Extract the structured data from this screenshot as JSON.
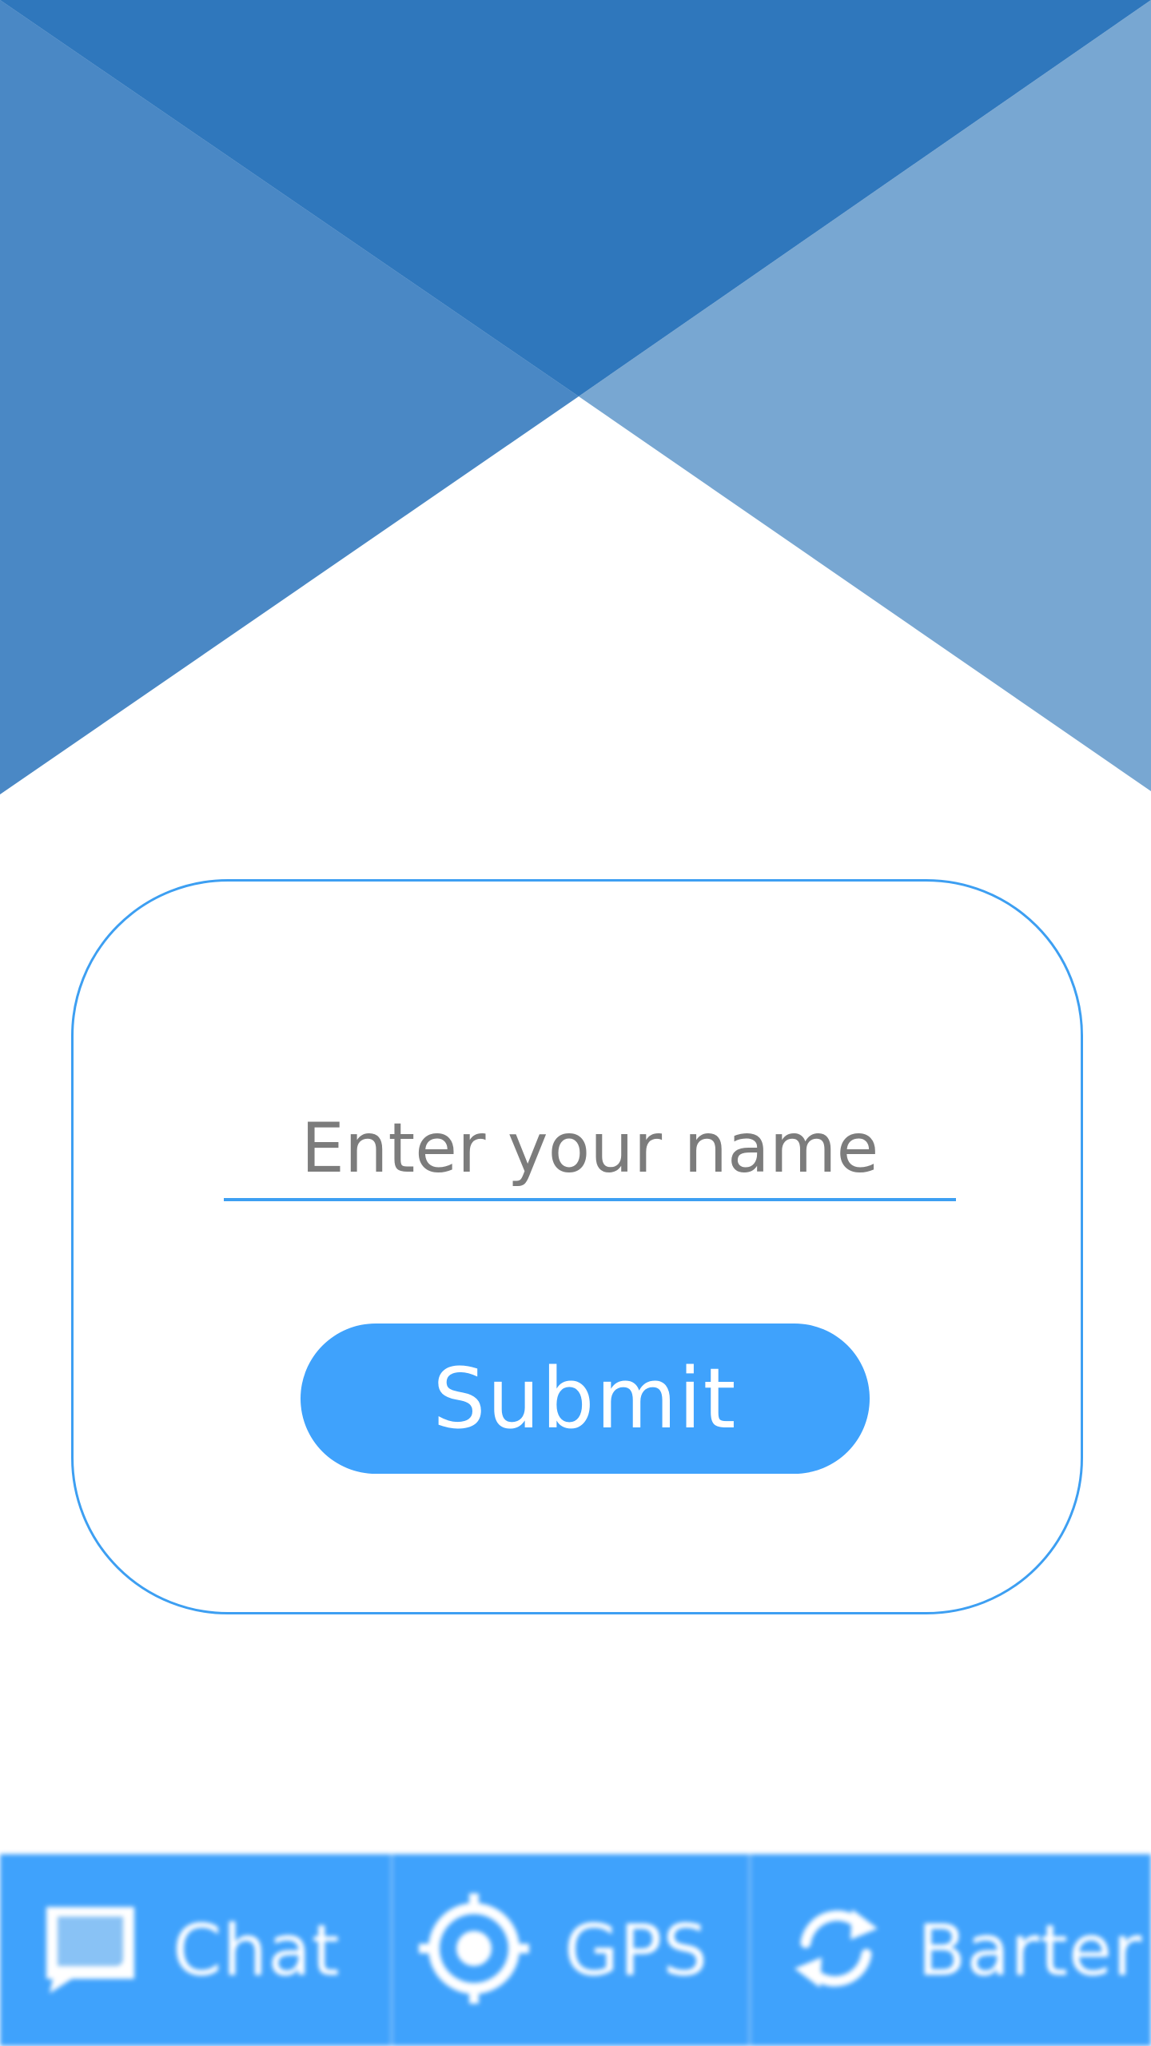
{
  "form": {
    "name_placeholder": "Enter your name",
    "name_value": "",
    "submit_label": "Submit"
  },
  "bottom_nav": {
    "items": [
      {
        "label": "Chat",
        "icon": "chat-bubble-icon"
      },
      {
        "label": "GPS",
        "icon": "gps-target-icon"
      },
      {
        "label": "Barter",
        "icon": "exchange-arrows-icon"
      }
    ]
  },
  "colors": {
    "banner_dark": "#2f77bc",
    "banner_mid": "#4a88c5",
    "banner_light": "#78a7d2",
    "accent": "#3fa2fc",
    "card_border": "#3d9ff2",
    "placeholder_text": "#7c7c7c"
  }
}
